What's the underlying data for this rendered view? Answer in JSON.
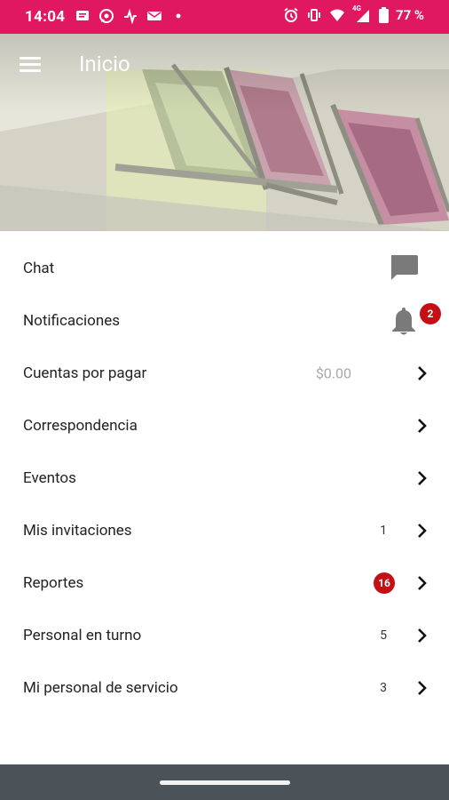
{
  "status_bar": {
    "time": "14:04",
    "network": "4G",
    "battery_percent": "77 %",
    "left_icons": [
      "message-icon",
      "whatsapp-icon",
      "activity-icon",
      "mail-icon",
      "dot-icon"
    ],
    "right_icons": [
      "alarm-icon",
      "vibrate-icon",
      "wifi-icon",
      "signal-icon",
      "battery-icon"
    ]
  },
  "header": {
    "title": "Inicio"
  },
  "menu": {
    "chat": {
      "label": "Chat"
    },
    "notifications": {
      "label": "Notificaciones",
      "badge": "2"
    },
    "payables": {
      "label": "Cuentas por pagar",
      "amount": "$0.00"
    },
    "mail": {
      "label": "Correspondencia"
    },
    "events": {
      "label": "Eventos"
    },
    "invitations": {
      "label": "Mis invitaciones",
      "count": "1"
    },
    "reports": {
      "label": "Reportes",
      "badge": "16"
    },
    "staff_on_shift": {
      "label": "Personal en turno",
      "count": "5"
    },
    "service_staff": {
      "label": "Mi personal de servicio",
      "count": "3"
    }
  },
  "colors": {
    "accent": "#e0185f",
    "badge": "#c41015",
    "nav_bar": "#4c5358"
  }
}
